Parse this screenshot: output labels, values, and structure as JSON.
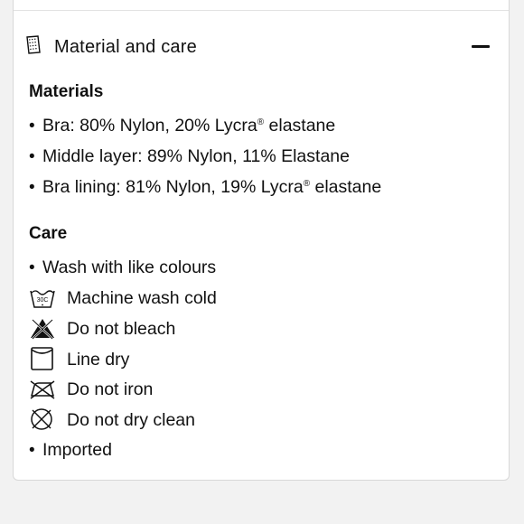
{
  "accordion": {
    "title": "Material and care",
    "header_icon": "fabric-tag-icon",
    "toggle_icon": "minus-icon",
    "expanded": true
  },
  "materials": {
    "heading": "Materials",
    "items": [
      "Bra: 80% Nylon, 20% Lycra® elastane",
      "Middle layer: 89% Nylon, 11% Elastane",
      "Bra lining: 81% Nylon, 19% Lycra® elastane"
    ]
  },
  "care": {
    "heading": "Care",
    "items": [
      {
        "text": "Wash with like colours",
        "icon": "bullet"
      },
      {
        "text": "Machine wash cold",
        "icon": "wash-30c-icon",
        "icon_label": "30C"
      },
      {
        "text": "Do not bleach",
        "icon": "no-bleach-icon"
      },
      {
        "text": "Line dry",
        "icon": "line-dry-icon"
      },
      {
        "text": "Do not iron",
        "icon": "no-iron-icon"
      },
      {
        "text": "Do not dry clean",
        "icon": "no-dry-clean-icon"
      },
      {
        "text": "Imported",
        "icon": "bullet"
      }
    ]
  }
}
